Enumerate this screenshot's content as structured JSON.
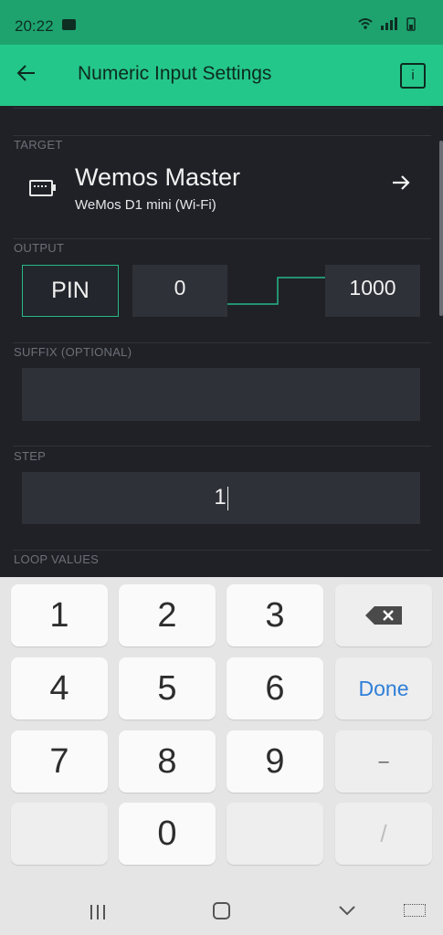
{
  "status_bar": {
    "time": "20:22",
    "icons": [
      "mail-icon",
      "wifi-icon",
      "signal-icon",
      "battery-icon"
    ]
  },
  "app_bar": {
    "title": "Numeric Input Settings",
    "back_icon": "arrow-left-icon",
    "info_label": "i"
  },
  "target": {
    "section_label": "TARGET",
    "name": "Wemos Master",
    "device": "WeMos D1 mini (Wi-Fi)"
  },
  "output": {
    "section_label": "OUTPUT",
    "pin_label": "PIN",
    "min_value": "0",
    "max_value": "1000"
  },
  "suffix": {
    "section_label": "SUFFIX (OPTIONAL)",
    "value": ""
  },
  "step": {
    "section_label": "STEP",
    "value": "1"
  },
  "loop_values": {
    "section_label": "LOOP VALUES"
  },
  "keyboard": {
    "keys": [
      "1",
      "2",
      "3",
      "4",
      "5",
      "6",
      "7",
      "8",
      "9",
      "0"
    ],
    "done_label": "Done",
    "minus_label": "–",
    "slash_label": "/"
  },
  "colors": {
    "accent": "#24c78a",
    "status_bar": "#1ea36f",
    "background": "#1f2127",
    "done": "#2f7fd8"
  }
}
